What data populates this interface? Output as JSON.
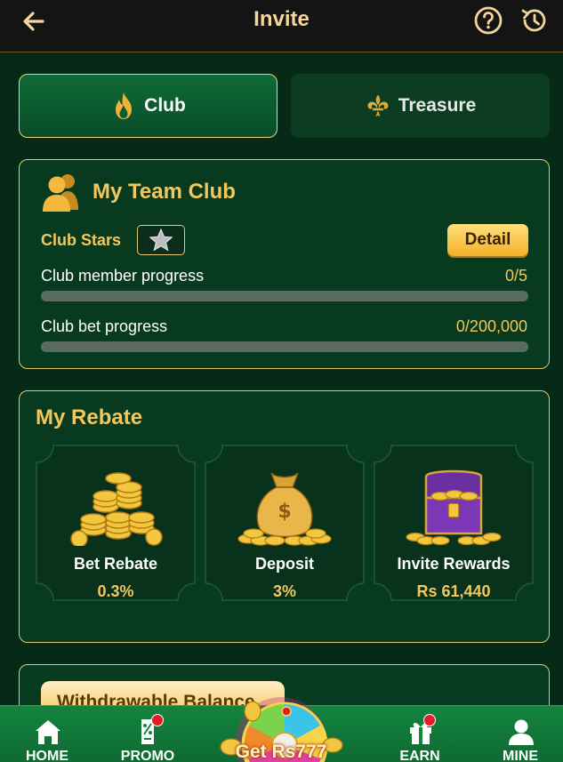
{
  "header": {
    "title": "Invite",
    "back_icon": "back-arrow-icon",
    "help_icon": "question-circle-icon",
    "history_icon": "history-icon"
  },
  "tabs": [
    {
      "label": "Club",
      "icon": "flame-icon",
      "active": true
    },
    {
      "label": "Treasure",
      "icon": "fleur-de-lis-icon",
      "active": false
    }
  ],
  "club": {
    "title": "My Team Club",
    "stars_label": "Club Stars",
    "detail_label": "Detail",
    "member_progress": {
      "label": "Club member progress",
      "value_text": "0/5",
      "fraction": 0
    },
    "bet_progress": {
      "label": "Club bet progress",
      "value_text": "0/200,000",
      "fraction": 0
    }
  },
  "rebate": {
    "title": "My Rebate",
    "items": [
      {
        "label": "Bet Rebate",
        "value": "0.3%",
        "icon": "coin-stack-icon"
      },
      {
        "label": "Deposit",
        "value": "3%",
        "icon": "money-bag-icon"
      },
      {
        "label": "Invite Rewards",
        "value": "Rs 61,440",
        "icon": "treasure-chest-icon"
      }
    ]
  },
  "withdraw": {
    "label": "Withdrawable Balance"
  },
  "nav": {
    "items": [
      {
        "label": "HOME",
        "icon": "home-icon"
      },
      {
        "label": "PROMO",
        "icon": "promo-icon"
      },
      {
        "label": "EARN",
        "icon": "gift-icon"
      },
      {
        "label": "MINE",
        "icon": "user-icon"
      }
    ],
    "center_label": "Get Rs777"
  },
  "colors": {
    "background": "#052a17",
    "gold_text": "#f4c75c",
    "card_border": "#e7c674",
    "nav_green": "#14843f",
    "badge_red": "#e11d2a"
  }
}
